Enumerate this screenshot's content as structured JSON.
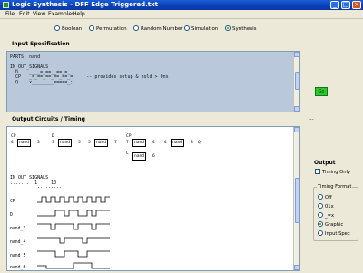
{
  "window": {
    "title": "Logic Synthesis - DFF Edge Triggered.txt"
  },
  "menu": [
    "File",
    "Edit",
    "View",
    "Examples",
    "Help"
  ],
  "modes": [
    {
      "label": "Boolean",
      "selected": false
    },
    {
      "label": "Permutation",
      "selected": false
    },
    {
      "label": "Random Number",
      "selected": false
    },
    {
      "label": "Simulation",
      "selected": false
    },
    {
      "label": "Synthesis",
      "selected": true
    }
  ],
  "input_section": {
    "label": "Input Specification",
    "text": "PARTS  nand\n\nIN_OUT_SIGNALS\n  D    ____=_==__==_=_ ;\n  CP   _=_==_==_==_==_=;    -- provides setup & hold > 0ns\n  Q    x________=====_;"
  },
  "go_label": "Go",
  "dots_label": "...",
  "output_section": {
    "label": "Output Circuits / Timing",
    "gates": [
      {
        "in_top": "CP",
        "in_bot": "4",
        "name": "nand",
        "out": "3"
      },
      {
        "in_top": "D",
        "in_bot": "3",
        "name": "nand",
        "out": "5"
      },
      {
        "in_top": "",
        "in_bot": "5",
        "name": "nand",
        "out": "7"
      },
      {
        "in_top": "CP",
        "in_bot": "7",
        "name": "nand",
        "out": "4"
      },
      {
        "in_top": "",
        "in_bot": "4",
        "name": "nand",
        "out": "8"
      },
      {
        "in_top": "",
        "in_bot": "",
        "name": "nand",
        "out": "6"
      }
    ],
    "gate_q_label": "Q",
    "gate_c_label": "C",
    "signals_header": "IN_OUT_SIGNALS",
    "ruler": ".......  1     10\n          .........",
    "signals": [
      "CP",
      "D",
      "nand_3",
      "nand_4",
      "nand_5",
      "nand_6"
    ]
  },
  "output_panel": {
    "label": "Output",
    "timing_only": "Timing Only",
    "format_legend": "Timing Format",
    "formats": [
      {
        "label": "Off",
        "selected": false
      },
      {
        "label": "01x",
        "selected": false
      },
      {
        "label": "_=x",
        "selected": false
      },
      {
        "label": "Graphic",
        "selected": true
      },
      {
        "label": "Input Spec",
        "selected": false
      }
    ]
  },
  "colors": {
    "accent": "#0a3fb3",
    "spec_bg": "#b9c9db",
    "go": "#2fc52f"
  }
}
